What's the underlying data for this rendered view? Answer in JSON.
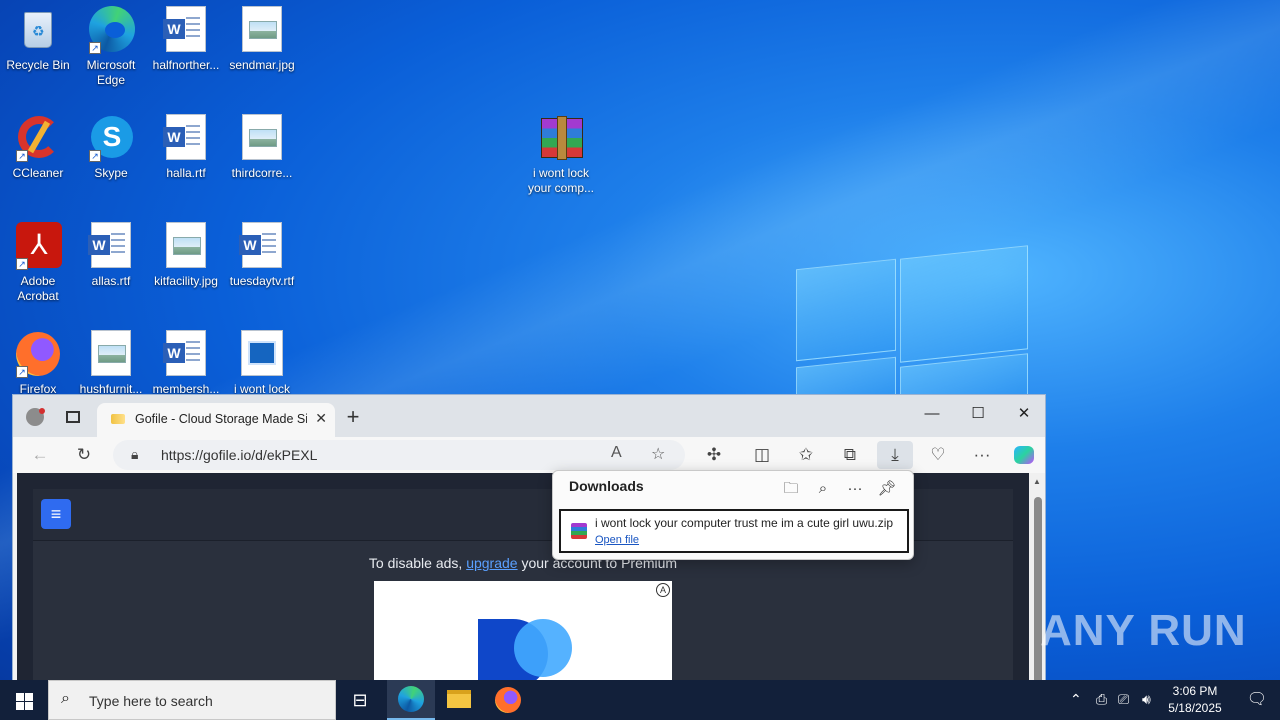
{
  "desktop": {
    "icons": [
      {
        "label": "Recycle Bin"
      },
      {
        "label": "Microsoft Edge"
      },
      {
        "label": "halfnorther..."
      },
      {
        "label": "sendmar.jpg"
      },
      {
        "label": "CCleaner"
      },
      {
        "label": "Skype"
      },
      {
        "label": "halla.rtf"
      },
      {
        "label": "thirdcorre..."
      },
      {
        "label": "i wont lock your comp..."
      },
      {
        "label": "Adobe Acrobat"
      },
      {
        "label": "allas.rtf"
      },
      {
        "label": "kitfacility.jpg"
      },
      {
        "label": "tuesdaytv.rtf"
      },
      {
        "label": "Firefox"
      },
      {
        "label": "hushfurnit..."
      },
      {
        "label": "membersh..."
      },
      {
        "label": "i wont lock"
      }
    ]
  },
  "browser": {
    "tab_title": "Gofile - Cloud Storage Made Sim",
    "url": "https://gofile.io/d/ekPEXL",
    "page": {
      "ad_text_prefix": "To disable ads, ",
      "ad_link": "upgrade",
      "ad_text_suffix": " your account to Premium"
    }
  },
  "downloads": {
    "title": "Downloads",
    "file_name": "i wont lock your computer trust me im a cute girl uwu.zip",
    "open_label": "Open file"
  },
  "watermark": "ANY RUN",
  "taskbar": {
    "search_placeholder": "Type here to search",
    "time": "3:06 PM",
    "date": "5/18/2025"
  }
}
